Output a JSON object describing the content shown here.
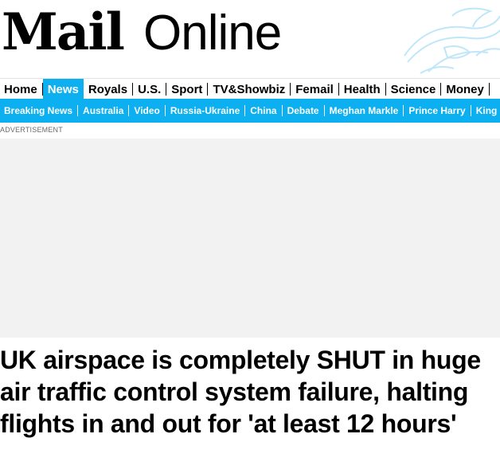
{
  "brand": {
    "logo_mail": "Mail",
    "logo_online": "Online"
  },
  "primary_nav": [
    {
      "label": "Home",
      "active": false
    },
    {
      "label": "News",
      "active": true
    },
    {
      "label": "Royals",
      "active": false
    },
    {
      "label": "U.S.",
      "active": false
    },
    {
      "label": "Sport",
      "active": false
    },
    {
      "label": "TV&Showbiz",
      "active": false
    },
    {
      "label": "Femail",
      "active": false
    },
    {
      "label": "Health",
      "active": false
    },
    {
      "label": "Science",
      "active": false
    },
    {
      "label": "Money",
      "active": false
    }
  ],
  "secondary_nav": [
    "Breaking News",
    "Australia",
    "Video",
    "Russia-Ukraine",
    "China",
    "Debate",
    "Meghan Markle",
    "Prince Harry",
    "King"
  ],
  "ad": {
    "label": "ADVERTISEMENT"
  },
  "article": {
    "headline": "UK airspace is completely SHUT in huge air traffic control system failure, halting flights in and out for 'at least 12 hours'"
  },
  "colors": {
    "accent": "#0cb0f0",
    "ad_background": "#f2f2f2"
  },
  "icons": {
    "decoration": "bird-outline-icon"
  }
}
